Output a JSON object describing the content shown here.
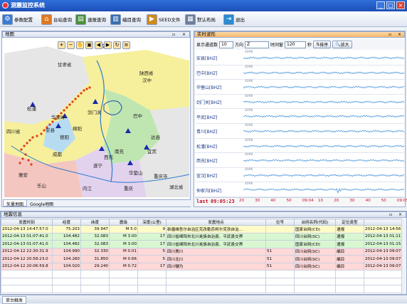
{
  "app": {
    "title": "测震监控系统"
  },
  "window_controls": {
    "minimize": "_",
    "maximize": "□",
    "close": "×"
  },
  "toolbar": {
    "items": [
      {
        "label": "参数配置",
        "icon": "gear-icon",
        "color": "#3a7bd5"
      },
      {
        "label": "台站查询",
        "icon": "house-icon",
        "color": "#e07a1f"
      },
      {
        "label": "速报查询",
        "icon": "document-icon",
        "color": "#4a8f3a"
      },
      {
        "label": "编目查询",
        "icon": "book-icon",
        "color": "#3a6fb0"
      },
      {
        "label": "SEED文件",
        "icon": "play-icon",
        "color": "#d08a1a"
      },
      {
        "label": "默认布局",
        "icon": "layout-icon",
        "color": "#6b7f99"
      },
      {
        "label": "退出",
        "icon": "exit-icon",
        "color": "#2a8bd0"
      }
    ]
  },
  "map_panel": {
    "title": "地图",
    "tabs": [
      "矢量地图",
      "Google地图"
    ],
    "tools": [
      "zoom-in-icon",
      "zoom-out-icon",
      "pan-icon",
      "full-extent-icon",
      "back-icon",
      "forward-icon",
      "refresh-icon",
      "layers-icon"
    ],
    "places": [
      {
        "name": "成县"
      },
      {
        "name": "甘肃省"
      },
      {
        "name": "陕西省"
      },
      {
        "name": "汉中"
      },
      {
        "name": "剑门关"
      },
      {
        "name": "巴中"
      },
      {
        "name": "达县"
      },
      {
        "name": "四川省"
      },
      {
        "name": "松潘"
      },
      {
        "name": "华家岭"
      },
      {
        "name": "安县"
      },
      {
        "name": "绵阳"
      },
      {
        "name": "德阳"
      },
      {
        "name": "成都"
      },
      {
        "name": "雅安"
      },
      {
        "name": "乐山"
      },
      {
        "name": "内江"
      },
      {
        "name": "遂宁"
      },
      {
        "name": "南充"
      },
      {
        "name": "华蓥山"
      },
      {
        "name": "重庆市"
      },
      {
        "name": "重庆"
      },
      {
        "name": "湖北省"
      },
      {
        "name": "宜宾"
      },
      {
        "name": "西充"
      }
    ],
    "colors": {
      "province_a": "#f6ef9b",
      "province_b": "#b7dcf2",
      "province_c": "#bfe6b0",
      "province_d": "#f3c6c0",
      "province_e": "#e2d2ee",
      "event_dot": "#e23a1a",
      "station": "#1a2aa8"
    }
  },
  "wave_panel": {
    "title": "实时波形",
    "channels_label": "显示通道数",
    "channels_value": "10",
    "direction_label": "方向",
    "direction_value": "Z",
    "window_label": "时间窗",
    "window_value": "120",
    "window_unit": "秒",
    "sort_button": "排序",
    "zoom_button": "放大",
    "channels": [
      {
        "name": "安县[BHZ]",
        "amp": "4096"
      },
      {
        "name": "巴中[BHZ]",
        "amp": "4096"
      },
      {
        "name": "华蓥山[BHZ]",
        "amp": "4096"
      },
      {
        "name": "剑门关[BHZ]",
        "amp": "4096"
      },
      {
        "name": "平武[BHZ]",
        "amp": "4096"
      },
      {
        "name": "青川[BHZ]",
        "amp": "4096"
      },
      {
        "name": "松潘[BHZ]",
        "amp": "4096"
      },
      {
        "name": "西充[BHZ]",
        "amp": "4096"
      },
      {
        "name": "宣汉[BHZ]",
        "amp": "4096"
      },
      {
        "name": "仲家沟[BHZ]",
        "amp": "4096"
      }
    ],
    "last_time_label": "last",
    "last_time": "09:05:23",
    "time_ticks": [
      "20",
      "30",
      "40",
      "50",
      "09:04",
      "10",
      "20",
      "30",
      "40",
      "50",
      "09:05"
    ],
    "colors": {
      "trace": "#1a7ad0",
      "last": "#c0102a",
      "time_axis": "#c0102a"
    }
  },
  "eq_panel": {
    "title": "地震信息",
    "columns": [
      "发震时刻",
      "经度",
      "纬度",
      "震级",
      "深度(公里)",
      "发震地点",
      "位号",
      "台网名称(代码)",
      "定位类型",
      ""
    ],
    "rows": [
      {
        "time": "2012-04-13 14:47:57.0",
        "lon": "75.203",
        "lat": "39.947",
        "mag": "M 5.0",
        "depth": "9",
        "place": "新疆维吾尔自治区克孜勒苏柯尔克孜自治...",
        "pos": "",
        "net": "国家台网(CD)",
        "type": "速报",
        "ts": "2012-04-13 14:56:1",
        "style": "r-y"
      },
      {
        "time": "2012-04-13 01:07:41.0",
        "lon": "104.482",
        "lat": "32.083",
        "mag": "M 3.00",
        "depth": "17",
        "place": "四川省绵阳市北川羌族自治县、平武县交界",
        "pos": "",
        "net": "四川台网(SC)",
        "type": "速报",
        "ts": "2012-04-13 01:11:5",
        "style": "r-g"
      },
      {
        "time": "2012-04-13 01:07:41.0",
        "lon": "104.482",
        "lat": "32.083",
        "mag": "M 3.00",
        "depth": "17",
        "place": "四川省绵阳市北川羌族自治县、平武县交界",
        "pos": "",
        "net": "国家台网(CD)",
        "type": "速报",
        "ts": "2012-04-13 01:15:1",
        "style": "r-g"
      },
      {
        "time": "2012-04-12 22:30:31.9",
        "lon": "104.990",
        "lat": "32.330",
        "mag": "M 0.01",
        "depth": "5",
        "place": "四川青川",
        "pos": "51",
        "net": "四川台网(SC)",
        "type": "编目",
        "ts": "2012-04-13 09:07:3",
        "style": "r-p"
      },
      {
        "time": "2012-04-12 20:58:23.0",
        "lon": "104.260",
        "lat": "31.850",
        "mag": "M 0.66",
        "depth": "5",
        "place": "四川北川",
        "pos": "51",
        "net": "四川台网(SC)",
        "type": "编目",
        "ts": "2012-04-13 09:07:3",
        "style": "r-p"
      },
      {
        "time": "2012-04-12 20:06:59.8",
        "lon": "104.020",
        "lat": "29.240",
        "mag": "M 0.72",
        "depth": "17",
        "place": "四川犍为",
        "pos": "51",
        "net": "四川台网(SC)",
        "type": "编目",
        "ts": "2012-04-13 09:07:3",
        "style": "r-p"
      },
      {
        "time": "",
        "lon": "",
        "lat": "",
        "mag": "",
        "depth": "",
        "place": "",
        "pos": "",
        "net": "",
        "type": "",
        "ts": "",
        "style": "r-w"
      },
      {
        "time": "",
        "lon": "",
        "lat": "",
        "mag": "",
        "depth": "",
        "place": "",
        "pos": "",
        "net": "",
        "type": "",
        "ts": "",
        "style": "r-w"
      },
      {
        "time": "",
        "lon": "",
        "lat": "",
        "mag": "",
        "depth": "",
        "place": "",
        "pos": "",
        "net": "",
        "type": "",
        "ts": "",
        "style": "r-w"
      }
    ]
  },
  "status": {
    "tab": "单台触发"
  }
}
